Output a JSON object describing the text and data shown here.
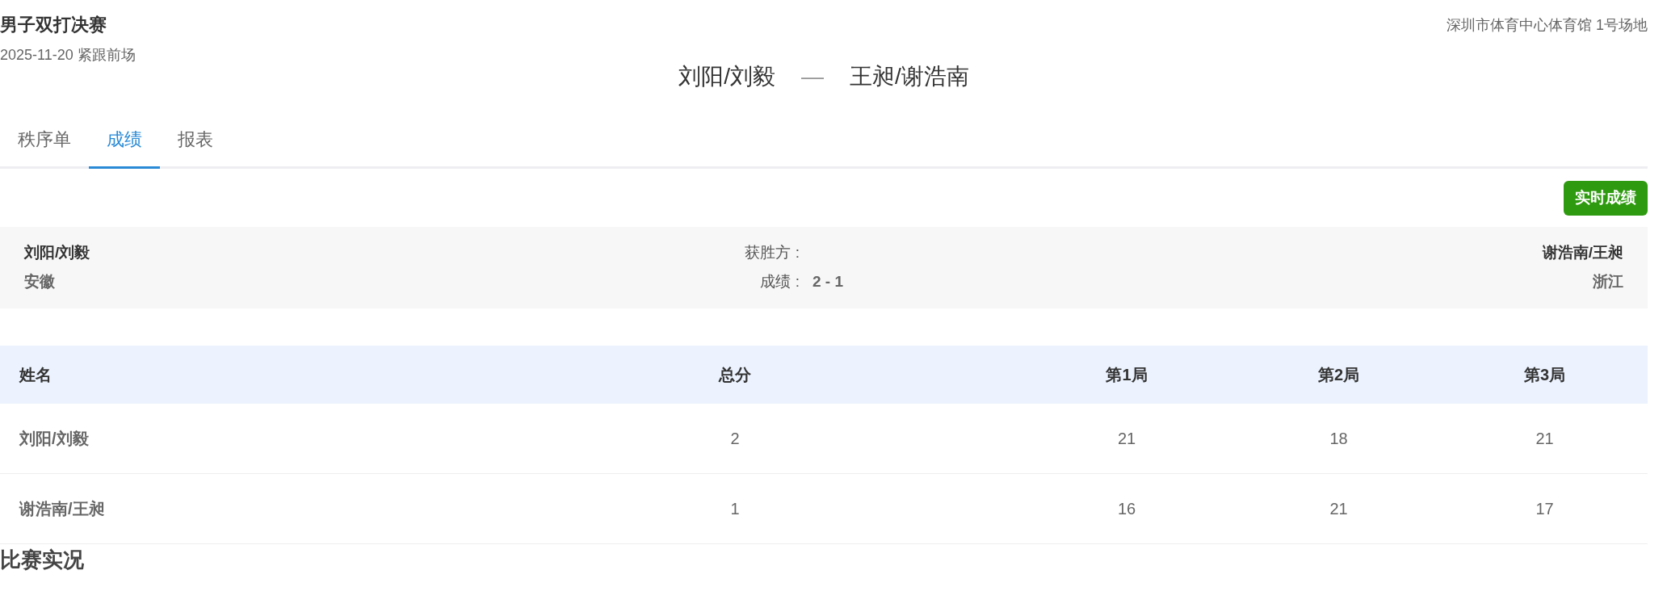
{
  "header": {
    "title": "男子双打决赛",
    "subtitle": "2025-11-20 紧跟前场",
    "venue": "深圳市体育中心体育馆 1号场地"
  },
  "matchup": {
    "left": "刘阳/刘毅",
    "separator": "—",
    "right": "王昶/谢浩南"
  },
  "tabs": [
    {
      "label": "秩序单",
      "selected": false
    },
    {
      "label": "成绩",
      "selected": true
    },
    {
      "label": "报表",
      "selected": false
    }
  ],
  "live_button": "实时成绩",
  "summary": {
    "left_team": "刘阳/刘毅",
    "left_region": "安徽",
    "winner_label": "获胜方 :",
    "score_label": "成绩 :",
    "score": "2 - 1",
    "right_team": "谢浩南/王昶",
    "right_region": "浙江"
  },
  "table": {
    "columns": [
      "姓名",
      "总分",
      "第1局",
      "第2局",
      "第3局"
    ],
    "rows": [
      [
        "刘阳/刘毅",
        "2",
        "21",
        "18",
        "21"
      ],
      [
        "谢浩南/王昶",
        "1",
        "16",
        "21",
        "17"
      ]
    ]
  },
  "section_title": "比赛实况"
}
